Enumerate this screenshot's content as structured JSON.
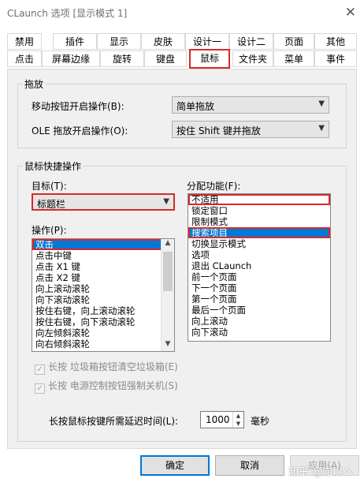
{
  "window": {
    "title": "CLaunch 选项 [显示模式 1]",
    "close_glyph": "✕"
  },
  "tabs": {
    "row1": [
      "禁用",
      "插件",
      "显示",
      "皮肤",
      "设计一",
      "设计二",
      "页面",
      "其他"
    ],
    "row2": [
      "点击",
      "屏幕边缘",
      "旋转",
      "键盘",
      "鼠标",
      "文件夹",
      "菜单",
      "事件"
    ],
    "active": "鼠标"
  },
  "drag": {
    "title": "拖放",
    "move_label": "移动按钮开启操作(B):",
    "move_value": "简单拖放",
    "ole_label": "OLE 拖放开启操作(O):",
    "ole_value": "按住 Shift 键并拖放"
  },
  "shortcut": {
    "title": "鼠标快捷操作",
    "target_label": "目标(T):",
    "target_value": "标题栏",
    "operation_label": "操作(P):",
    "operations": [
      "双击",
      "点击中键",
      "点击 X1 键",
      "点击 X2 键",
      "向上滚动滚轮",
      "向下滚动滚轮",
      "按住右键，向上滚动滚轮",
      "按住右键，向下滚动滚轮",
      "向左倾斜滚轮",
      "向右倾斜滚轮"
    ],
    "function_label": "分配功能(F):",
    "functions": [
      "不适用",
      "锁定窗口",
      "限制模式",
      "搜索项目",
      "切换显示模式",
      "选项",
      "退出 CLaunch",
      "前一个页面",
      "下一个页面",
      "第一个页面",
      "最后一个页面",
      "向上滚动",
      "向下滚动"
    ]
  },
  "options": {
    "trash_label": "长按 垃圾箱按钮清空垃圾箱(E)",
    "power_label": "长按 电源控制按钮强制关机(S)",
    "check_glyph": "✓",
    "delay_label": "长按鼠标按键所需延迟时间(L):",
    "delay_value": "1000",
    "delay_unit": "毫秒"
  },
  "buttons": {
    "ok": "确定",
    "cancel": "取消",
    "apply": "应用(A)"
  },
  "watermark": "知乎 @向以へ",
  "icons": {
    "dropdown": "▼",
    "up": "▲",
    "down": "▼"
  },
  "colors": {
    "accent": "#0078d7",
    "highlight_border": "#d62a2a",
    "selected_bg": "#0078d7"
  }
}
